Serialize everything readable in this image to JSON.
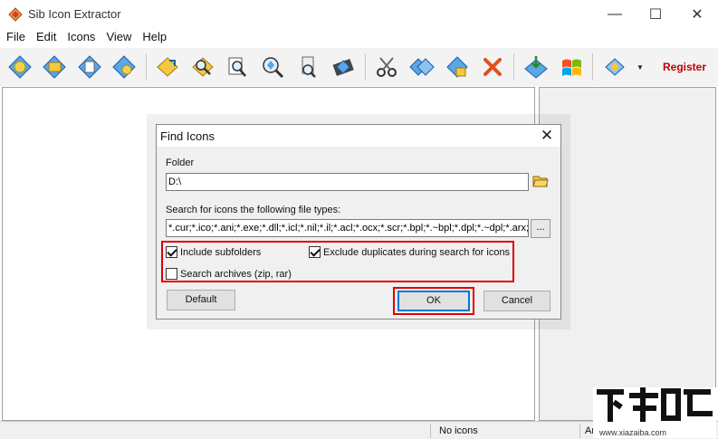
{
  "window": {
    "title": "Sib Icon Extractor",
    "icon": "app-diamond-icon",
    "controls": {
      "minimize": "—",
      "maximize": "☐",
      "close": "✕"
    }
  },
  "menu": [
    "File",
    "Edit",
    "Icons",
    "View",
    "Help"
  ],
  "toolbar": {
    "buttons": [
      "open-globe-icon",
      "open-folder-icon",
      "open-file-icon",
      "refresh-icon",
      "add-folder-icon",
      "find-icon",
      "find-list-icon",
      "search-icon",
      "inspect-file-icon",
      "film-icon",
      "cut-icon",
      "copy-icon",
      "paste-icon",
      "delete-icon",
      "save-icon",
      "windows-flag-icon",
      "settings-icon"
    ],
    "register_label": "Register"
  },
  "dialog": {
    "title": "Find Icons",
    "close_glyph": "✕",
    "folder_label": "Folder",
    "folder_value": "D:\\",
    "filetypes_label": "Search for icons the following file types:",
    "filetypes_value": "*.cur;*.ico;*.ani;*.exe;*.dll;*.icl;*.nil;*.il;*.acl;*.ocx;*.scr;*.bpl;*.~bpl;*.dpl;*.~dpl;*.arx;*.c",
    "browse_label": "...",
    "include_subfolders": {
      "label": "Include subfolders",
      "checked": true
    },
    "exclude_duplicates": {
      "label": "Exclude duplicates during search for icons",
      "checked": true
    },
    "search_archives": {
      "label": "Search archives (zip, rar)",
      "checked": false
    },
    "default_label": "Default",
    "ok_label": "OK",
    "cancel_label": "Cancel"
  },
  "status": {
    "no_icons": "No icons",
    "right_partial": "Ar"
  },
  "watermark": {
    "url": "www.xiazaiba.com"
  },
  "colors": {
    "highlight": "#e00000",
    "register": "#c00000",
    "focus": "#0078d7"
  }
}
